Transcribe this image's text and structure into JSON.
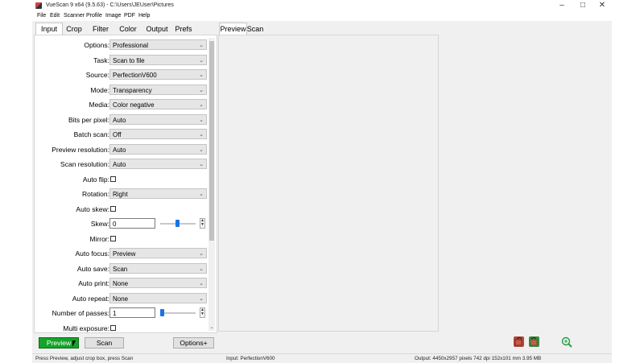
{
  "window": {
    "title": "VueScan 9 x64 (9.5.63) - C:\\Users\\JEUser\\Pictures",
    "controls": [
      "minimize-icon",
      "maximize-icon",
      "close-icon"
    ]
  },
  "menu": [
    "File",
    "Edit",
    "Scanner",
    "Profile",
    "Image",
    "PDF",
    "Help"
  ],
  "left_tabs": [
    "Input",
    "Crop",
    "Filter",
    "Color",
    "Output",
    "Prefs"
  ],
  "left_active_tab": "Input",
  "settings": {
    "options": {
      "label": "Options:",
      "value": "Professional"
    },
    "task": {
      "label": "Task:",
      "value": "Scan to file"
    },
    "source": {
      "label": "Source:",
      "value": "PerfectionV600"
    },
    "mode": {
      "label": "Mode:",
      "value": "Transparency"
    },
    "media": {
      "label": "Media:",
      "value": "Color negative"
    },
    "bits": {
      "label": "Bits per pixel:",
      "value": "Auto"
    },
    "batch": {
      "label": "Batch scan:",
      "value": "Off"
    },
    "preview_res": {
      "label": "Preview resolution:",
      "value": "Auto"
    },
    "scan_res": {
      "label": "Scan resolution:",
      "value": "Auto"
    },
    "auto_flip": {
      "label": "Auto flip:",
      "checked": false
    },
    "rotation": {
      "label": "Rotation:",
      "value": "Right"
    },
    "auto_skew": {
      "label": "Auto skew:",
      "checked": false
    },
    "skew": {
      "label": "Skew:",
      "value": "0"
    },
    "mirror": {
      "label": "Mirror:",
      "checked": false
    },
    "auto_focus": {
      "label": "Auto focus:",
      "value": "Preview"
    },
    "auto_save": {
      "label": "Auto save:",
      "value": "Scan"
    },
    "auto_print": {
      "label": "Auto print:",
      "value": "None"
    },
    "auto_repeat": {
      "label": "Auto repeat:",
      "value": "None"
    },
    "passes": {
      "label": "Number of passes:",
      "value": "1"
    },
    "multi_exposure": {
      "label": "Multi exposure:",
      "checked": false
    }
  },
  "right_tabs": [
    "Preview",
    "Scan"
  ],
  "right_active_tab": "Preview",
  "buttons": {
    "preview": "Preview",
    "scan": "Scan",
    "options": "Options+"
  },
  "status": {
    "left": "Press Preview, adjust crop box, press Scan",
    "middle": "Input: PerfectionV600",
    "right": "Output: 4450x2957 pixels 742 dpi 152x101 mm 3.95 MB"
  },
  "colors": {
    "preview_button": "#16a32a",
    "slider_thumb": "#1a73e8"
  }
}
